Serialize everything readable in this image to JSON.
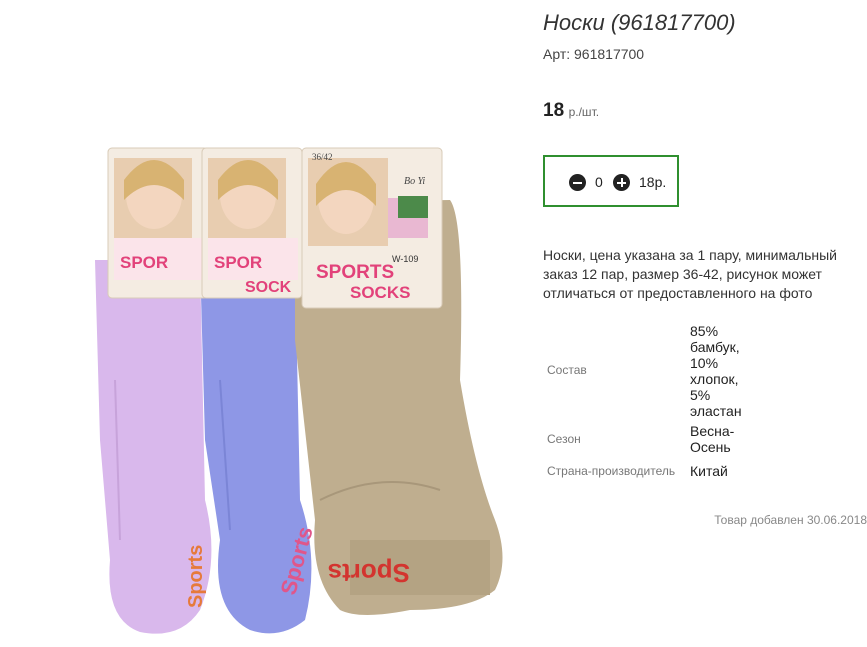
{
  "product": {
    "title": "Носки (961817700)",
    "sku": "Арт: 961817700",
    "price_value": "18",
    "price_unit": "р./шт.",
    "quantity": "0",
    "total": "18р.",
    "description": "Носки, цена указана за 1 пару, минимальный заказ 12 пар, размер 36-42, рисунок может отличаться от предоставленного на фото",
    "specs": [
      {
        "label": "Состав",
        "value": "85% бамбук, 10% хлопок, 5% эластан"
      },
      {
        "label": "Сезон",
        "value": "Весна-Осень"
      },
      {
        "label": "Страна-производитель",
        "value": "Китай"
      }
    ],
    "added": "Товар добавлен 30.06.2018"
  },
  "image": {
    "package_text_top": "36/42",
    "brand": "Bo Yi",
    "model": "W-109",
    "label_line1": "SPORTS",
    "label_line2": "SOCKS",
    "sole_text": "Sports"
  },
  "colors": {
    "accent_border": "#2f8f2f",
    "sock_lilac": "#d9b8ec",
    "sock_blue": "#8e97e6",
    "sock_beige": "#bfae8f"
  }
}
